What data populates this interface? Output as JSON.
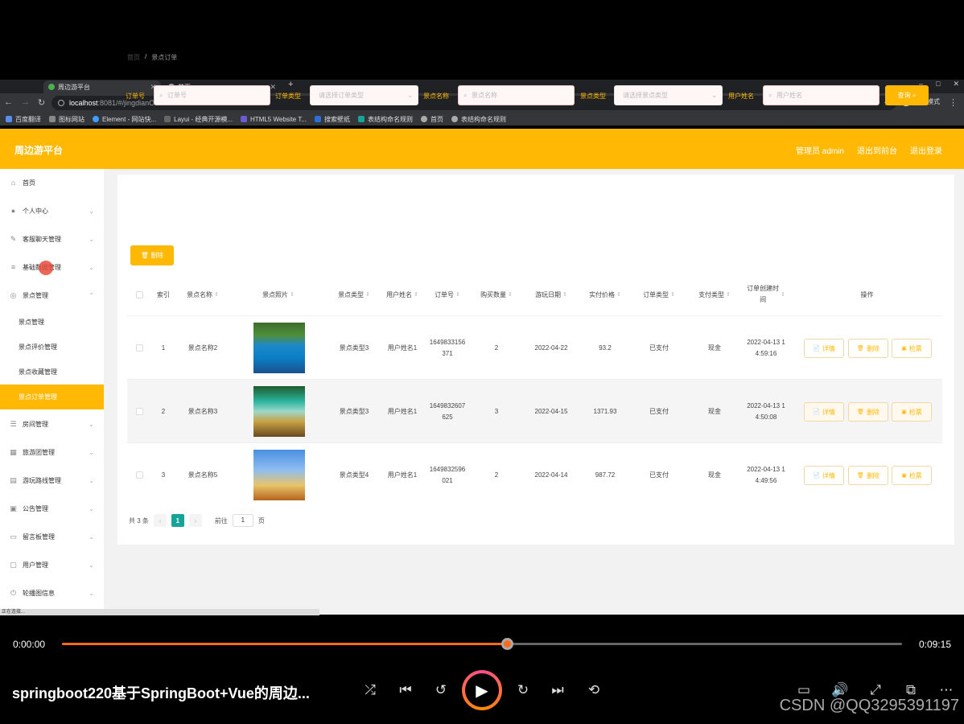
{
  "browser": {
    "tabs": [
      {
        "label": "周边游平台",
        "active": true
      },
      {
        "label": "首页",
        "active": false
      }
    ],
    "window_controls": [
      "–",
      "□",
      "✕"
    ],
    "url_host": "localhost",
    "url_rest": ":8081/#/jingdianOrder",
    "incognito_label": "无痕模式",
    "bookmarks": [
      "百度翻译",
      "图标网站",
      "Element - 网站快...",
      "Layui - 经典开源模...",
      "HTML5 Website T...",
      "搜索壁纸",
      "表结构命名规则",
      "首页",
      "表结构命名规则"
    ]
  },
  "header": {
    "brand": "周边游平台",
    "admin": "管理员 admin",
    "to_front": "退出到前台",
    "logout": "退出登录"
  },
  "sidebar": {
    "items": [
      {
        "label": "首页",
        "icon": "home-icon",
        "glyph": "⌂",
        "chevron": ""
      },
      {
        "label": "个人中心",
        "icon": "user-icon",
        "glyph": "●",
        "chevron": "⌄"
      },
      {
        "label": "客服聊天管理",
        "icon": "chat-icon",
        "glyph": "✎",
        "chevron": "⌄"
      },
      {
        "label": "基础数据管理",
        "icon": "menu-icon",
        "glyph": "≡",
        "chevron": "⌄"
      },
      {
        "label": "景点管理",
        "icon": "compass-icon",
        "glyph": "◎",
        "chevron": "⌃"
      },
      {
        "label": "景点管理",
        "sub": true
      },
      {
        "label": "景点评价管理",
        "sub": true
      },
      {
        "label": "景点收藏管理",
        "sub": true
      },
      {
        "label": "景点订单管理",
        "sub": true,
        "active": true
      },
      {
        "label": "房间管理",
        "icon": "sliders-icon",
        "glyph": "☰",
        "chevron": "⌄"
      },
      {
        "label": "旅游团管理",
        "icon": "grid-icon",
        "glyph": "▦",
        "chevron": "⌄"
      },
      {
        "label": "游玩路线管理",
        "icon": "route-icon",
        "glyph": "▤",
        "chevron": "⌄"
      },
      {
        "label": "公告管理",
        "icon": "notice-icon",
        "glyph": "▣",
        "chevron": "⌄"
      },
      {
        "label": "留言板管理",
        "icon": "monitor-icon",
        "glyph": "▭",
        "chevron": "⌄"
      },
      {
        "label": "用户管理",
        "icon": "users-icon",
        "glyph": "▢",
        "chevron": "⌄"
      },
      {
        "label": "轮播图信息",
        "icon": "power-icon",
        "glyph": "⏻",
        "chevron": "⌄"
      }
    ]
  },
  "breadcrumb": {
    "home": "首页",
    "sep": "/",
    "current": "景点订单"
  },
  "filters": {
    "order_no_label": "订单号",
    "order_no_placeholder": "订单号",
    "order_type_label": "订单类型",
    "order_type_placeholder": "请选择订单类型",
    "spot_name_label": "景点名称",
    "spot_name_placeholder": "景点名称",
    "spot_type_label": "景点类型",
    "spot_type_placeholder": "请选择景点类型",
    "user_name_label": "用户姓名",
    "user_name_placeholder": "用户姓名",
    "search_button": "查询",
    "delete_button": "删除"
  },
  "table": {
    "headers": [
      "索引",
      "景点名称",
      "景点照片",
      "景点类型",
      "用户姓名",
      "订单号",
      "购买数量",
      "游玩日期",
      "实付价格",
      "订单类型",
      "支付类型",
      "订单创建时间",
      "操作"
    ],
    "rows": [
      {
        "index": "1",
        "name": "景点名称2",
        "type": "景点类型3",
        "user": "用户姓名1",
        "order_no": "1649833156371",
        "qty": "2",
        "date": "2022-04-22",
        "price": "93.2",
        "status": "已支付",
        "pay": "现金",
        "created": "2022-04-13 14:59:16",
        "photo": "lake"
      },
      {
        "index": "2",
        "name": "景点名称3",
        "type": "景点类型3",
        "user": "用户姓名1",
        "order_no": "1649832607625",
        "qty": "3",
        "date": "2022-04-15",
        "price": "1371.93",
        "status": "已支付",
        "pay": "现金",
        "created": "2022-04-13 14:50:08",
        "photo": "waterfall"
      },
      {
        "index": "3",
        "name": "景点名称5",
        "type": "景点类型4",
        "user": "用户姓名1",
        "order_no": "1649832596021",
        "qty": "2",
        "date": "2022-04-14",
        "price": "987.72",
        "status": "已支付",
        "pay": "现金",
        "created": "2022-04-13 14:49:56",
        "photo": "pagoda"
      }
    ],
    "actions": {
      "detail": "详情",
      "delete": "删除",
      "check": "检票"
    }
  },
  "pagination": {
    "total": "共 3 条",
    "page": "1",
    "goto": "前往",
    "goto_value": "1",
    "page_unit": "页",
    "prev": "‹",
    "next": "›"
  },
  "status_text": "正在连接...",
  "player": {
    "current_time": "0:00:00",
    "duration": "0:09:15",
    "progress": 0.53,
    "title": "springboot220基于SpringBoot+Vue的周边...",
    "watermark": "CSDN @QQ3295391197"
  },
  "colors": {
    "accent": "#ffb904",
    "pager_active": "#17a398",
    "progress": "#ff6a1a"
  }
}
